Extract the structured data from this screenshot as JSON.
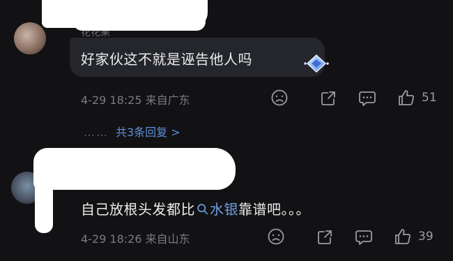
{
  "comments": [
    {
      "username_partial": "花花果",
      "text": "好家伙这不就是诬告他人吗",
      "date": "4-29",
      "time": "18:25",
      "location": "来自广东",
      "likes": "51",
      "replies_label": "共3条回复 >",
      "replies_dots": "……"
    },
    {
      "text_before": "自己放根头发都比",
      "link_text": "水银",
      "text_after": "靠谱吧。。。",
      "date": "4-29",
      "time": "18:26",
      "location": "来自山东",
      "likes": "39"
    }
  ],
  "colors": {
    "background": "#121214",
    "link": "#5f8fd9",
    "muted": "#7b7b80"
  }
}
